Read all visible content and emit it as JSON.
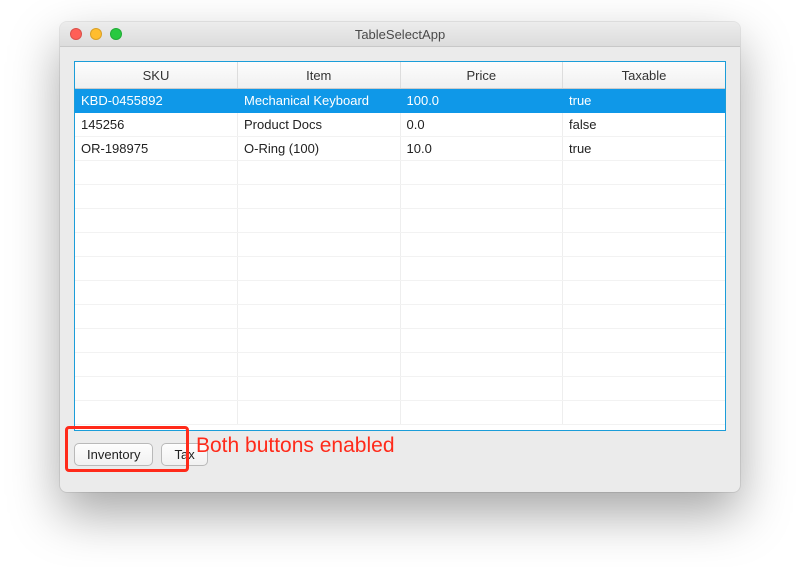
{
  "window": {
    "title": "TableSelectApp"
  },
  "table": {
    "headers": [
      "SKU",
      "Item",
      "Price",
      "Taxable"
    ],
    "rows": [
      {
        "sku": "KBD-0455892",
        "item": "Mechanical Keyboard",
        "price": "100.0",
        "taxable": "true",
        "selected": true
      },
      {
        "sku": "145256",
        "item": "Product Docs",
        "price": "0.0",
        "taxable": "false",
        "selected": false
      },
      {
        "sku": "OR-198975",
        "item": "O-Ring (100)",
        "price": "10.0",
        "taxable": "true",
        "selected": false
      }
    ],
    "visible_row_slots": 14
  },
  "buttons": {
    "inventory": "Inventory",
    "tax": "Tax"
  },
  "annotation": {
    "label": "Both buttons enabled"
  }
}
